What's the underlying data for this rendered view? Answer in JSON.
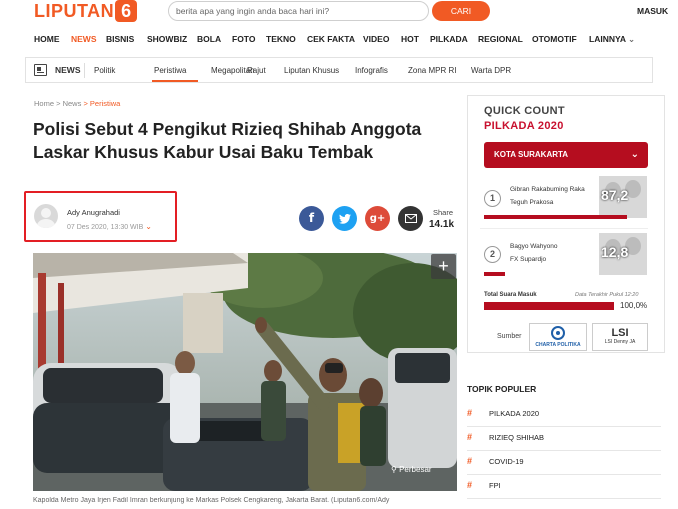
{
  "header": {
    "logo_text": "LIPUTAN",
    "logo_number": "6",
    "search_placeholder": "berita apa yang ingin anda baca hari ini?",
    "search_button": "CARI",
    "login": "MASUK"
  },
  "main_nav": [
    "HOME",
    "NEWS",
    "BISNIS",
    "SHOWBIZ",
    "BOLA",
    "FOTO",
    "TEKNO",
    "CEK FAKTA",
    "VIDEO",
    "HOT",
    "PILKADA",
    "REGIONAL",
    "OTOMOTIF",
    "LAINNYA"
  ],
  "main_nav_active": "NEWS",
  "sub_nav": {
    "section": "NEWS",
    "items": [
      "Politik",
      "Peristiwa",
      "Megapolitan",
      "Rajut",
      "Liputan Khusus",
      "Infografis",
      "Zona MPR RI",
      "Warta DPR"
    ],
    "active": "Peristiwa"
  },
  "breadcrumb": [
    "Home",
    "News",
    "Peristiwa"
  ],
  "article": {
    "title": "Polisi Sebut 4 Pengikut Rizieq Shihab Anggota Laskar Khusus Kabur Usai Baku Tembak",
    "author": "Ady Anugrahadi",
    "date": "07 Des 2020, 13:30 WIB",
    "share_label": "Share",
    "share_count": "14.1k",
    "photo_action": "Perbesar",
    "caption": "Kapolda Metro Jaya Irjen Fadil Imran berkunjung ke Markas Polsek Cengkareng, Jakarta Barat. (Liputan6.com/Ady"
  },
  "quick_count": {
    "title_line1": "QUICK COUNT",
    "title_line2": "PILKADA 2020",
    "region": "KOTA SURAKARTA",
    "candidates": [
      {
        "number": "1",
        "name_line1": "Gibran Rakabuming Raka",
        "name_line2": "Teguh Prakosa",
        "percent": "87,2",
        "percent_value": 87.2
      },
      {
        "number": "2",
        "name_line1": "Bagyo Wahyono",
        "name_line2": "FX Supardjo",
        "percent": "12,8",
        "percent_value": 12.8
      }
    ],
    "total_label": "Total Suara Masuk",
    "last_update": "Data Terakhir Pukul 12:20",
    "total_percent": "100,0%",
    "total_value": 100,
    "source_label": "Sumber",
    "sources": [
      "CHARTA POLITIKA",
      "LSI Denny JA"
    ],
    "accent_color": "#b50d1f"
  },
  "topik_populer": {
    "title": "TOPIK POPULER",
    "items": [
      "PILKADA 2020",
      "RIZIEQ SHIHAB",
      "COVID-19",
      "FPI"
    ]
  },
  "colors": {
    "brand": "#f15a24",
    "highlight_box": "#e31e24"
  }
}
